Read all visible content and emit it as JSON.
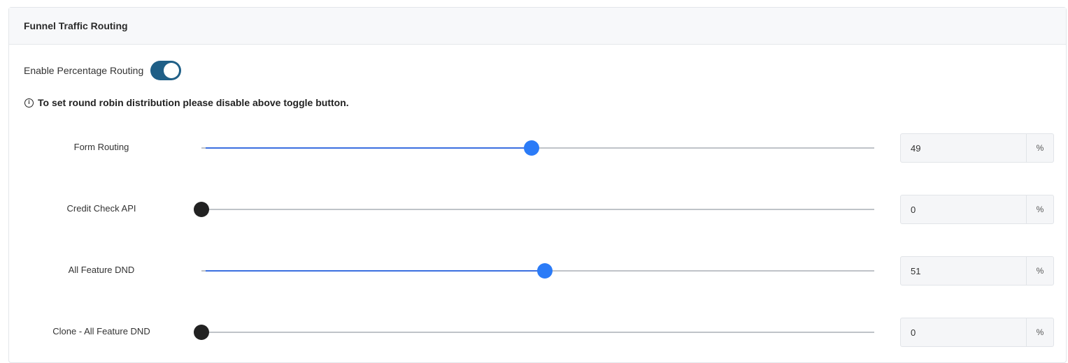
{
  "header": {
    "title": "Funnel Traffic Routing"
  },
  "toggle": {
    "label": "Enable Percentage Routing",
    "enabled": true
  },
  "info": {
    "text": "To set round robin distribution please disable above toggle button."
  },
  "routes": [
    {
      "label": "Form Routing",
      "value": "49",
      "unit": "%"
    },
    {
      "label": "Credit Check API",
      "value": "0",
      "unit": "%"
    },
    {
      "label": "All Feature DND",
      "value": "51",
      "unit": "%"
    },
    {
      "label": "Clone - All Feature DND",
      "value": "0",
      "unit": "%"
    }
  ],
  "colors": {
    "accent": "#2b7bf7",
    "toggle_on": "#1f5f87",
    "thumb_zero": "#222222"
  }
}
